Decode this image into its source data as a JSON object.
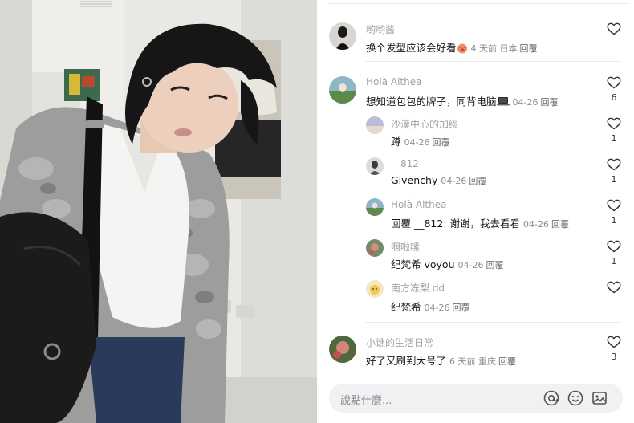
{
  "comments": [
    {
      "name": "哟哟酱",
      "text": "换个发型应该会好看",
      "emoji": "pig-face-emoji",
      "meta": "4 天前 日本",
      "reply": "回覆",
      "likes": ""
    },
    {
      "name": "Holà Althea",
      "text": "想知道包包的牌子，同背电脑",
      "emoji": "laptop-emoji",
      "meta": "04-26",
      "reply": "回覆",
      "likes": "6"
    },
    {
      "name": "沙漠中心的加缪",
      "text": "蹲",
      "meta": "04-26",
      "reply": "回覆",
      "likes": "1"
    },
    {
      "name": "__812",
      "text": "Givenchy",
      "meta": "04-26",
      "reply": "回覆",
      "likes": "1"
    },
    {
      "name": "Holà Althea",
      "text": "回覆 __812: 谢谢，我去看看",
      "meta": "04-26",
      "reply": "回覆",
      "likes": "1"
    },
    {
      "name": "啊啦嗦",
      "text": "纪梵希 voyou",
      "meta": "04-26",
      "reply": "回覆",
      "likes": "1"
    },
    {
      "name": "南方冻梨 dd",
      "text": "纪梵希",
      "meta": "04-26",
      "reply": "回覆",
      "likes": ""
    },
    {
      "name": "小谯的生活日常",
      "text": "好了又刷到大号了",
      "meta": "6 天前 重庆",
      "reply": "回覆",
      "likes": "3"
    }
  ],
  "input": {
    "placeholder": "說點什麼...",
    "mention_icon": "at-icon",
    "emoji_icon": "smiley-icon",
    "image_icon": "image-icon"
  },
  "colors": {
    "name_text": "#a1a1a6",
    "meta_text": "#8e8e93",
    "input_bg": "#f1f1f3"
  }
}
